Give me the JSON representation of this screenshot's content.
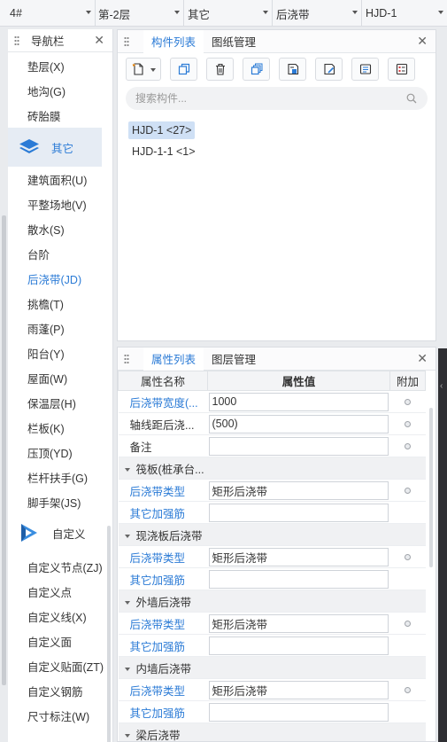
{
  "topbar": {
    "dropdowns": [
      {
        "value": "4#"
      },
      {
        "value": "第-2层"
      },
      {
        "value": "其它"
      },
      {
        "value": "后浇带"
      },
      {
        "value": "HJD-1"
      }
    ]
  },
  "nav": {
    "title": "导航栏",
    "items_top": [
      "垫层(X)",
      "地沟(G)",
      "砖胎膜"
    ],
    "group_other": "其它",
    "items_other": [
      "建筑面积(U)",
      "平整场地(V)",
      "散水(S)",
      "台阶",
      "后浇带(JD)",
      "挑檐(T)",
      "雨蓬(P)",
      "阳台(Y)",
      "屋面(W)",
      "保温层(H)",
      "栏板(K)",
      "压顶(YD)",
      "栏杆扶手(G)",
      "脚手架(JS)"
    ],
    "active_item": "后浇带(JD)",
    "group_custom": "自定义",
    "items_custom": [
      "自定义节点(ZJ)",
      "自定义点",
      "自定义线(X)",
      "自定义面",
      "自定义贴面(ZT)",
      "自定义钢筋",
      "尺寸标注(W)"
    ]
  },
  "component_panel": {
    "tabs": [
      "构件列表",
      "图纸管理"
    ],
    "search_placeholder": "搜索构件...",
    "items": [
      {
        "label": "HJD-1 <27>",
        "selected": true
      },
      {
        "label": "HJD-1-1 <1>",
        "selected": false
      }
    ]
  },
  "property_panel": {
    "tabs": [
      "属性列表",
      "图层管理"
    ],
    "columns": [
      "属性名称",
      "属性值",
      "附加"
    ],
    "rows": [
      {
        "kind": "prop",
        "name": "后浇带宽度(...",
        "value": "1000",
        "blue": true,
        "dot": true
      },
      {
        "kind": "prop",
        "name": "轴线距后浇...",
        "value": "(500)",
        "blue": false,
        "dot": true
      },
      {
        "kind": "prop",
        "name": "备注",
        "value": "",
        "blue": false,
        "dot": true
      },
      {
        "kind": "group",
        "name": "筏板(桩承台..."
      },
      {
        "kind": "prop",
        "name": "后浇带类型",
        "value": "矩形后浇带",
        "blue": true,
        "dot": true
      },
      {
        "kind": "prop",
        "name": "其它加强筋",
        "value": "",
        "blue": true,
        "dot": false
      },
      {
        "kind": "group",
        "name": "现浇板后浇带"
      },
      {
        "kind": "prop",
        "name": "后浇带类型",
        "value": "矩形后浇带",
        "blue": true,
        "dot": true
      },
      {
        "kind": "prop",
        "name": "其它加强筋",
        "value": "",
        "blue": true,
        "dot": false
      },
      {
        "kind": "group",
        "name": "外墙后浇带"
      },
      {
        "kind": "prop",
        "name": "后浇带类型",
        "value": "矩形后浇带",
        "blue": true,
        "dot": true
      },
      {
        "kind": "prop",
        "name": "其它加强筋",
        "value": "",
        "blue": true,
        "dot": false
      },
      {
        "kind": "group",
        "name": "内墙后浇带"
      },
      {
        "kind": "prop",
        "name": "后浇带类型",
        "value": "矩形后浇带",
        "blue": true,
        "dot": true
      },
      {
        "kind": "prop",
        "name": "其它加强筋",
        "value": "",
        "blue": true,
        "dot": false
      },
      {
        "kind": "group",
        "name": "梁后浇带"
      }
    ]
  },
  "colors": {
    "accent": "#2b7bd6",
    "selected_bg": "#cfe0f5",
    "nav_selected_bg": "#e6ecf4"
  }
}
